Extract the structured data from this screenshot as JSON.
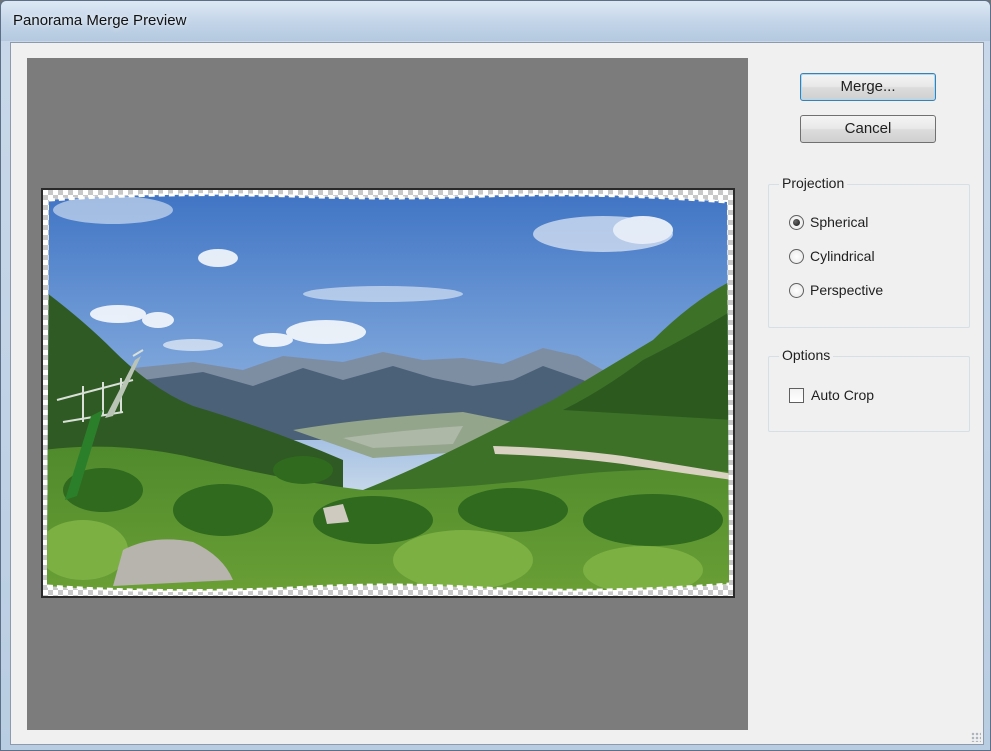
{
  "window": {
    "title": "Panorama Merge Preview"
  },
  "buttons": {
    "merge_label": "Merge...",
    "cancel_label": "Cancel"
  },
  "projection": {
    "label": "Projection",
    "options": [
      {
        "label": "Spherical",
        "selected": true
      },
      {
        "label": "Cylindrical",
        "selected": false
      },
      {
        "label": "Perspective",
        "selected": false
      }
    ]
  },
  "options": {
    "label": "Options",
    "auto_crop": {
      "label": "Auto Crop",
      "checked": false
    }
  },
  "preview": {
    "background_color": "#7b7c7b",
    "image_subject": "mountain-valley-panorama"
  }
}
